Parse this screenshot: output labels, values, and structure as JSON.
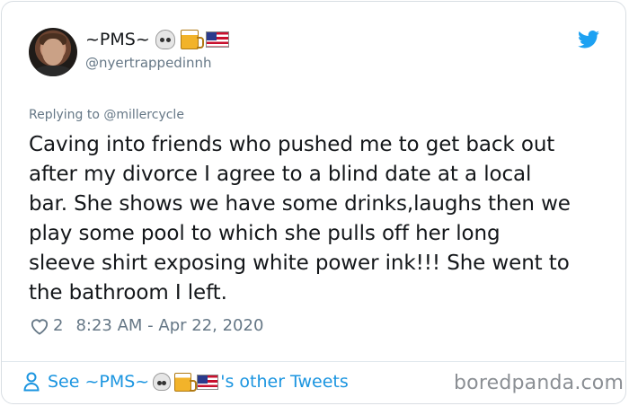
{
  "tweet": {
    "display_name": "~PMS~",
    "handle": "@nyertrappedinnh",
    "name_emojis": [
      "skull-emoji",
      "beer-emoji",
      "us-flag-emoji"
    ],
    "replying_to": "Replying to @millercycle",
    "text": "Caving into friends who pushed me to get back out\nafter my divorce I agree to a blind date at a local\nbar. She shows we have some drinks,laughs then we\nplay some pool to which she pulls off her long\nsleeve shirt exposing white power ink!!! She went to\nthe bathroom I left.",
    "like_count": "2",
    "timestamp": "8:23 AM - Apr 22, 2020"
  },
  "footer": {
    "see_prefix": "See ~PMS~",
    "see_suffix": "'s other Tweets"
  },
  "watermark": "boredpanda.com",
  "colors": {
    "link": "#1b95e0",
    "muted": "#657786",
    "text": "#14171a",
    "twitter_blue": "#1da1f2"
  }
}
